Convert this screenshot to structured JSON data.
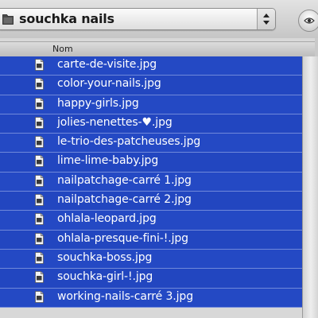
{
  "toolbar": {
    "folder_name": "souchka nails",
    "folder_icon": "folder-icon",
    "popup_arrows_icon": "up-down-arrows-icon",
    "action_icon": "eye-icon"
  },
  "list": {
    "column_header": "Nom",
    "selection_color": "#2449c4",
    "file_icon": "document-icon",
    "files": [
      "carte-de-visite.jpg",
      "color-your-nails.jpg",
      "happy-girls.jpg",
      "jolies-nenettes-♥.jpg",
      "le-trio-des-patcheuses.jpg",
      "lime-lime-baby.jpg",
      "nailpatchage-carré 1.jpg",
      "nailpatchage-carré 2.jpg",
      "ohlala-leopard.jpg",
      "ohlala-presque-fini-!.jpg",
      "souchka-boss.jpg",
      "souchka-girl-!.jpg",
      "working-nails-carré 3.jpg"
    ]
  }
}
